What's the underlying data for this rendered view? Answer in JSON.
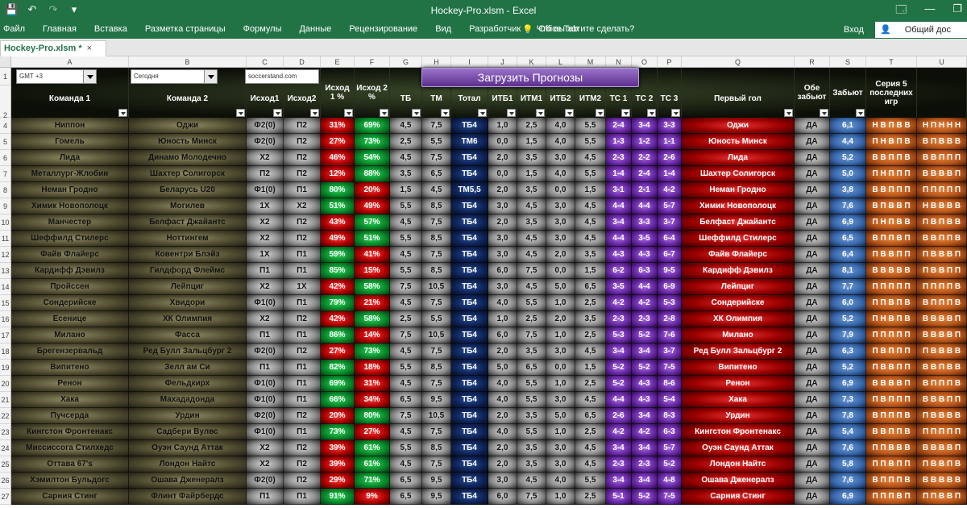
{
  "window": {
    "title": "Hockey-Pro.xlsm  -  Excel",
    "qat": {
      "save_icon": "💾",
      "undo_icon": "↶",
      "redo_icon": "↷",
      "customize_icon": "▾"
    },
    "controls": {
      "ribbon_options_icon": "🗔",
      "minimize_icon": "—",
      "restore_icon": "❐"
    }
  },
  "ribbon": {
    "tabs": [
      "Файл",
      "Главная",
      "Вставка",
      "Разметка страницы",
      "Формулы",
      "Данные",
      "Рецензирование",
      "Вид",
      "Разработчик",
      "Office Tab"
    ],
    "tell_me": "Что вы хотите сделать?",
    "signin": "Вход",
    "share": "Общий дос"
  },
  "workbook_tab": {
    "name": "Hockey-Pro.xlsm *",
    "close": "×"
  },
  "columns": [
    "A",
    "B",
    "C",
    "D",
    "E",
    "F",
    "G",
    "H",
    "I",
    "J",
    "K",
    "L",
    "M",
    "N",
    "O",
    "P",
    "Q",
    "R",
    "S",
    "T",
    "U"
  ],
  "row_numbers": [
    "1",
    "2",
    "4",
    "5",
    "6",
    "7",
    "8",
    "9",
    "10",
    "11",
    "12",
    "13",
    "14",
    "15",
    "16",
    "17",
    "18",
    "19",
    "20",
    "21",
    "22",
    "23",
    "24",
    "25",
    "26",
    "27"
  ],
  "dropdowns": {
    "timezone": "GMT +3",
    "day": "Сегодня",
    "source": "soccerstand.com"
  },
  "load_button": "Загрузить Прогнозы",
  "headers": [
    "Команда 1",
    "Команда 2",
    "Исход1",
    "Исход2",
    "Исход 1 %",
    "Исход 2 %",
    "ТБ",
    "ТМ",
    "Тотал",
    "ИТБ1",
    "ИТМ1",
    "ИТБ2",
    "ИТМ2",
    "ТС 1",
    "ТС 2",
    "ТС 3",
    "Первый гол",
    "Обе забьют",
    "Забьют",
    "Серия 5 последних игр",
    ""
  ],
  "rows": [
    [
      "Ниппон",
      "Оджи",
      "Ф2(0)",
      "П2",
      "31%",
      "69%",
      "4,5",
      "7,5",
      "ТБ4",
      "1,0",
      "2,5",
      "4,0",
      "5,5",
      "2-4",
      "3-4",
      "3-3",
      "Оджи",
      "ДА",
      "6,1",
      "Н В П В В",
      "Н П Н Н Н"
    ],
    [
      "Гомель",
      "Юность Минск",
      "Ф2(0)",
      "П2",
      "27%",
      "73%",
      "2,5",
      "5,5",
      "ТМ6",
      "0,0",
      "1,5",
      "4,0",
      "5,5",
      "1-3",
      "1-2",
      "1-1",
      "Юность Минск",
      "ДА",
      "4,4",
      "П Н В П В",
      "В П В В В"
    ],
    [
      "Лида",
      "Динамо Молодечно",
      "Х2",
      "П2",
      "46%",
      "54%",
      "4,5",
      "7,5",
      "ТБ4",
      "2,0",
      "3,5",
      "3,0",
      "4,5",
      "2-3",
      "2-2",
      "2-6",
      "Лида",
      "ДА",
      "5,2",
      "В В П П В",
      "В В П П П"
    ],
    [
      "Металлург-Жлобин",
      "Шахтер Солигорск",
      "П2",
      "П2",
      "12%",
      "88%",
      "3,5",
      "6,5",
      "ТБ4",
      "0,0",
      "1,5",
      "4,0",
      "5,5",
      "1-4",
      "2-4",
      "1-4",
      "Шахтер Солигорск",
      "ДА",
      "5,0",
      "П Н П П П",
      "В В В В П"
    ],
    [
      "Неман Гродно",
      "Беларусь U20",
      "Ф1(0)",
      "П1",
      "80%",
      "20%",
      "1,5",
      "4,5",
      "ТМ5,5",
      "2,0",
      "3,5",
      "0,0",
      "1,5",
      "3-1",
      "2-1",
      "4-2",
      "Неман Гродно",
      "ДА",
      "3,8",
      "В В П П П",
      "П П П П П"
    ],
    [
      "Химик Новополоцк",
      "Могилев",
      "1Х",
      "Х2",
      "51%",
      "49%",
      "5,5",
      "8,5",
      "ТБ4",
      "3,0",
      "4,5",
      "3,0",
      "4,5",
      "4-4",
      "4-4",
      "5-7",
      "Химик Новополоцк",
      "ДА",
      "7,6",
      "В П В В П",
      "Н В В В В"
    ],
    [
      "Манчестер",
      "Белфаст Джайантс",
      "Х2",
      "П2",
      "43%",
      "57%",
      "4,5",
      "7,5",
      "ТБ4",
      "2,0",
      "3,5",
      "3,0",
      "4,5",
      "3-4",
      "3-3",
      "3-7",
      "Белфаст Джайантс",
      "ДА",
      "6,9",
      "П Н П В В",
      "П В П В В"
    ],
    [
      "Шеффилд Стилерс",
      "Ноттингем",
      "Х2",
      "П2",
      "49%",
      "51%",
      "5,5",
      "8,5",
      "ТБ4",
      "3,0",
      "4,5",
      "3,0",
      "4,5",
      "4-4",
      "3-5",
      "6-4",
      "Шеффилд Стилерс",
      "ДА",
      "6,5",
      "В П П В П",
      "В В П П В"
    ],
    [
      "Файв Флайерс",
      "Ковентри Блэйз",
      "1Х",
      "П1",
      "59%",
      "41%",
      "4,5",
      "7,5",
      "ТБ4",
      "3,0",
      "4,5",
      "2,0",
      "3,5",
      "4-3",
      "4-3",
      "6-7",
      "Файв Флайерс",
      "ДА",
      "6,4",
      "П В В П П",
      "П В В В П"
    ],
    [
      "Кардифф Дэвилз",
      "Гилдфорд Флеймс",
      "П1",
      "П1",
      "85%",
      "15%",
      "5,5",
      "8,5",
      "ТБ4",
      "6,0",
      "7,5",
      "0,0",
      "1,5",
      "6-2",
      "6-3",
      "9-5",
      "Кардифф Дэвилз",
      "ДА",
      "8,1",
      "В В В В В",
      "П В В П П"
    ],
    [
      "Пройссен",
      "Лейпциг",
      "Х2",
      "1Х",
      "42%",
      "58%",
      "7,5",
      "10,5",
      "ТБ4",
      "3,0",
      "4,5",
      "5,0",
      "6,5",
      "3-5",
      "4-4",
      "6-9",
      "Лейпциг",
      "ДА",
      "7,7",
      "П П П П П",
      "П П П П В"
    ],
    [
      "Сондерийске",
      "Хвидори",
      "Ф1(0)",
      "П1",
      "79%",
      "21%",
      "4,5",
      "7,5",
      "ТБ4",
      "4,0",
      "5,5",
      "1,0",
      "2,5",
      "4-2",
      "4-2",
      "5-3",
      "Сондерийске",
      "ДА",
      "6,0",
      "П П В П В",
      "В П П П В"
    ],
    [
      "Есенице",
      "ХК Олимпия",
      "Х2",
      "П2",
      "42%",
      "58%",
      "2,5",
      "5,5",
      "ТБ4",
      "1,0",
      "2,5",
      "2,0",
      "3,5",
      "2-3",
      "2-3",
      "2-8",
      "ХК Олимпия",
      "ДА",
      "5,2",
      "П Н В П В",
      "В В В В П"
    ],
    [
      "Милано",
      "Фасса",
      "П1",
      "П1",
      "86%",
      "14%",
      "7,5",
      "10,5",
      "ТБ4",
      "6,0",
      "7,5",
      "1,0",
      "2,5",
      "5-3",
      "5-2",
      "7-6",
      "Милано",
      "ДА",
      "7,9",
      "П П П П П",
      "В В В В П"
    ],
    [
      "Брегензервальд",
      "Ред Булл Зальцбург 2",
      "Ф2(0)",
      "П2",
      "27%",
      "73%",
      "4,5",
      "7,5",
      "ТБ4",
      "2,0",
      "3,5",
      "3,0",
      "4,5",
      "3-4",
      "3-4",
      "3-7",
      "Ред Булл Зальцбург 2",
      "ДА",
      "6,3",
      "П В П П П",
      "П В В В В"
    ],
    [
      "Випитено",
      "Зелл ам Си",
      "П1",
      "П1",
      "82%",
      "18%",
      "5,5",
      "8,5",
      "ТБ4",
      "5,0",
      "6,5",
      "0,0",
      "1,5",
      "5-2",
      "5-2",
      "7-5",
      "Випитено",
      "ДА",
      "5,2",
      "П В В П П",
      "В В П В В"
    ],
    [
      "Ренон",
      "Фельдкирх",
      "Ф1(0)",
      "П1",
      "69%",
      "31%",
      "4,5",
      "7,5",
      "ТБ4",
      "4,0",
      "5,5",
      "1,0",
      "2,5",
      "5-2",
      "4-3",
      "8-6",
      "Ренон",
      "ДА",
      "6,9",
      "В В В В П",
      "В П П П В"
    ],
    [
      "Хака",
      "Махададонда",
      "Ф1(0)",
      "П1",
      "66%",
      "34%",
      "6,5",
      "9,5",
      "ТБ4",
      "4,0",
      "5,5",
      "3,0",
      "4,5",
      "4-4",
      "4-3",
      "5-4",
      "Хака",
      "ДА",
      "7,3",
      "П В П П П",
      "В В В П П"
    ],
    [
      "Пучсерда",
      "Урдин",
      "Ф2(0)",
      "П2",
      "20%",
      "80%",
      "7,5",
      "10,5",
      "ТБ4",
      "2,0",
      "3,5",
      "5,0",
      "6,5",
      "2-6",
      "3-4",
      "8-3",
      "Урдин",
      "ДА",
      "7,8",
      "В П П П В",
      "П В В В В"
    ],
    [
      "Кингстон Фронтенакс",
      "Садбери Вулвс",
      "Ф1(0)",
      "П1",
      "73%",
      "27%",
      "4,5",
      "7,5",
      "ТБ4",
      "4,0",
      "5,5",
      "1,0",
      "2,5",
      "4-2",
      "4-2",
      "6-3",
      "Кингстон Фронтенакс",
      "ДА",
      "5,4",
      "В В П П В",
      "П П П П П"
    ],
    [
      "Миссиссога Стилхедс",
      "Оуэн Саунд Аттак",
      "Х2",
      "П2",
      "39%",
      "61%",
      "5,5",
      "8,5",
      "ТБ4",
      "2,0",
      "3,5",
      "3,0",
      "4,5",
      "3-4",
      "3-4",
      "5-7",
      "Оуэн Саунд Аттак",
      "ДА",
      "7,6",
      "П П В В В",
      "В В В В П"
    ],
    [
      "Оттава 67's",
      "Лондон Найтс",
      "Х2",
      "П2",
      "39%",
      "61%",
      "4,5",
      "7,5",
      "ТБ4",
      "2,0",
      "3,5",
      "3,0",
      "4,5",
      "2-3",
      "2-3",
      "5-2",
      "Лондон Найтс",
      "ДА",
      "5,8",
      "П П В П П",
      "П В В П В"
    ],
    [
      "Хэмилтон Бульдогс",
      "Ошава Дженералз",
      "Ф2(0)",
      "П2",
      "29%",
      "71%",
      "6,5",
      "9,5",
      "ТБ4",
      "3,0",
      "4,5",
      "4,0",
      "5,5",
      "3-4",
      "3-4",
      "4-8",
      "Ошава Дженералз",
      "ДА",
      "7,6",
      "В П П П В",
      "В В В В В"
    ],
    [
      "Сарния Стинг",
      "Флинт Файрбердс",
      "П1",
      "П1",
      "91%",
      "9%",
      "6,5",
      "9,5",
      "ТБ4",
      "6,0",
      "7,5",
      "1,0",
      "2,5",
      "5-1",
      "5-2",
      "7-5",
      "Сарния Стинг",
      "ДА",
      "6,9",
      "П П П В П",
      "П П В В П"
    ]
  ],
  "colors": {
    "excel_green": "#217346",
    "load_button": "#7b4fb3"
  }
}
